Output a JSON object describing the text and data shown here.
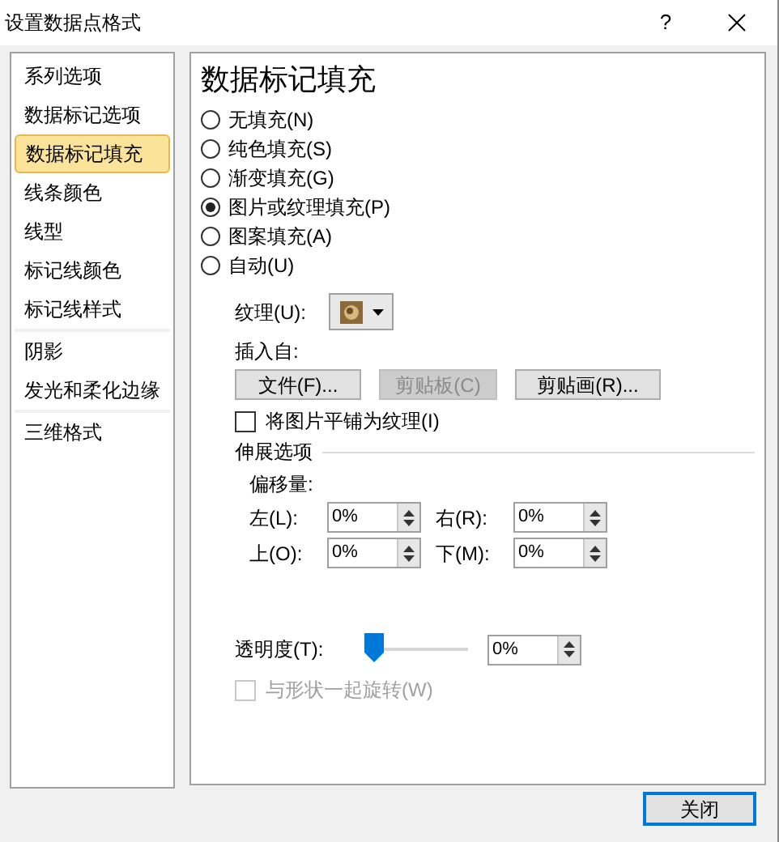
{
  "window": {
    "title": "设置数据点格式",
    "help": "?"
  },
  "sidebar": {
    "groups": [
      {
        "items": [
          {
            "label": "系列选项",
            "selected": false
          },
          {
            "label": "数据标记选项",
            "selected": false
          },
          {
            "label": "数据标记填充",
            "selected": true
          },
          {
            "label": "线条颜色",
            "selected": false
          },
          {
            "label": "线型",
            "selected": false
          },
          {
            "label": "标记线颜色",
            "selected": false
          },
          {
            "label": "标记线样式",
            "selected": false
          }
        ]
      },
      {
        "items": [
          {
            "label": "阴影",
            "selected": false
          },
          {
            "label": "发光和柔化边缘",
            "selected": false
          }
        ]
      },
      {
        "items": [
          {
            "label": "三维格式",
            "selected": false
          }
        ]
      }
    ]
  },
  "panel": {
    "heading": "数据标记填充",
    "fill_options": [
      {
        "label": "无填充(N)",
        "selected": false
      },
      {
        "label": "纯色填充(S)",
        "selected": false
      },
      {
        "label": "渐变填充(G)",
        "selected": false
      },
      {
        "label": "图片或纹理填充(P)",
        "selected": true
      },
      {
        "label": "图案填充(A)",
        "selected": false
      },
      {
        "label": "自动(U)",
        "selected": false
      }
    ],
    "texture_label": "纹理(U):",
    "insert_from_label": "插入自:",
    "insert_buttons": [
      {
        "label": "文件(F)...",
        "disabled": false
      },
      {
        "label": "剪贴板(C)",
        "disabled": true
      },
      {
        "label": "剪贴画(R)...",
        "disabled": false
      }
    ],
    "tile_checkbox": {
      "label": "将图片平铺为纹理(I)",
      "checked": false
    },
    "stretch_section": "伸展选项",
    "offset_label": "偏移量:",
    "offsets": [
      {
        "label": "左(L):",
        "value": "0%"
      },
      {
        "label": "右(R):",
        "value": "0%"
      },
      {
        "label": "上(O):",
        "value": "0%"
      },
      {
        "label": "下(M):",
        "value": "0%"
      }
    ],
    "transparency": {
      "label": "透明度(T):",
      "level": 0,
      "value": "0%"
    },
    "rotate_checkbox": {
      "label": "与形状一起旋转(W)",
      "checked": false,
      "disabled": true
    }
  },
  "close_button": "关闭"
}
